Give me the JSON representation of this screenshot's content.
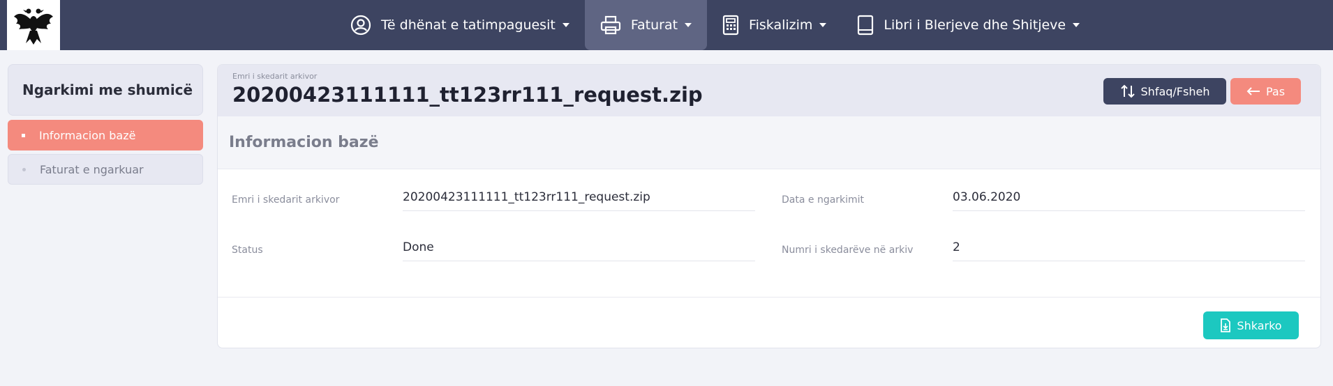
{
  "nav": {
    "items": [
      {
        "label": "Të dhënat e tatimpaguesit",
        "icon": "user-circle-icon"
      },
      {
        "label": "Faturat",
        "icon": "printer-icon",
        "active": true
      },
      {
        "label": "Fiskalizim",
        "icon": "calculator-icon"
      },
      {
        "label": "Libri i Blerjeve dhe Shitjeve",
        "icon": "book-icon"
      }
    ]
  },
  "sidebar": {
    "title": "Ngarkimi me shumicë",
    "items": [
      {
        "label": "Informacion bazë",
        "active": true
      },
      {
        "label": "Faturat e ngarkuar",
        "active": false
      }
    ]
  },
  "header": {
    "small_label": "Emri i skedarit arkivor",
    "title": "20200423111111_tt123rr111_request.zip",
    "toggle_label": "Shfaq/Fsheh",
    "back_label": "Pas"
  },
  "section": {
    "title": "Informacion bazë"
  },
  "fields": {
    "archive_name_label": "Emri i skedarit arkivor",
    "archive_name_value": "20200423111111_tt123rr111_request.zip",
    "upload_date_label": "Data e ngarkimit",
    "upload_date_value": "03.06.2020",
    "status_label": "Status",
    "status_value": "Done",
    "file_count_label": "Numri i skedarëve në arkiv",
    "file_count_value": "2"
  },
  "actions": {
    "download_label": "Shkarko"
  },
  "colors": {
    "nav_bg": "#3d4461",
    "accent_coral": "#f48a7e",
    "accent_teal": "#1cc8c0"
  }
}
